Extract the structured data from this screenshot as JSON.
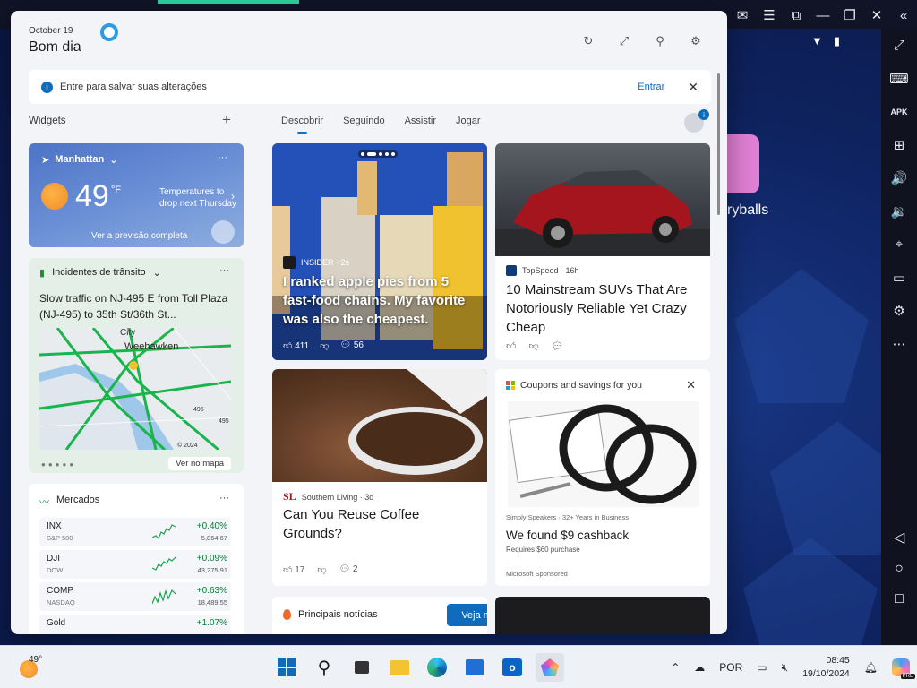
{
  "emulator": {
    "app_label": "ryballs",
    "top_icons": [
      "help-icon",
      "mail-icon",
      "menu-icon",
      "expand-icon",
      "minimize-icon",
      "restore-icon",
      "close-icon",
      "collapse-icon"
    ],
    "side_icons": [
      "fullscreen-icon",
      "keyboard-icon",
      "apk-icon",
      "add-window-icon",
      "volume-up-icon",
      "volume-down-icon",
      "location-icon",
      "folder-icon",
      "settings-icon",
      "more-icon"
    ]
  },
  "header": {
    "date": "October 19",
    "greeting": "Bom dia"
  },
  "banner": {
    "text": "Entre para salvar suas alterações",
    "action": "Entrar"
  },
  "widgets": {
    "label": "Widgets",
    "add": "+"
  },
  "tabs": [
    "Descobrir",
    "Seguindo",
    "Assistir",
    "Jogar"
  ],
  "avatar_badge": "i",
  "weather": {
    "location": "Manhattan",
    "temp": "49",
    "unit": "°F",
    "forecast": "Temperatures to drop next Thursday",
    "link": "Ver a previsão completa",
    "more": "···"
  },
  "traffic": {
    "title": "Incidentes de trânsito",
    "description": "Slow traffic on NJ-495 E from Toll Plaza (NJ-495) to 35th St/36th St...",
    "map_labels": {
      "city": "City",
      "weehawken": "Weehawken",
      "copyright": "© 2024",
      "route": "495",
      "route2": "495"
    },
    "button": "Ver no mapa",
    "more": "···"
  },
  "markets": {
    "title": "Mercados",
    "more": "···",
    "rows": [
      {
        "symbol": "INX",
        "name": "S&P 500",
        "change": "+0.40%",
        "value": "5,864.67"
      },
      {
        "symbol": "DJI",
        "name": "DOW",
        "change": "+0.09%",
        "value": "43,275.91"
      },
      {
        "symbol": "COMP",
        "name": "NASDAQ",
        "change": "+0.63%",
        "value": "18,489.55"
      },
      {
        "symbol": "Gold",
        "name": "",
        "change": "+1.07%",
        "value": ""
      }
    ]
  },
  "cards": {
    "apple": {
      "source": "INSIDER · 2s",
      "title": "I ranked apple pies from 5 fast-food chains. My favorite was also the cheapest.",
      "likes": "411",
      "comments": "56"
    },
    "suv": {
      "source": "TopSpeed · 16h",
      "title": "10 Mainstream SUVs That Are Notoriously Reliable Yet Crazy Cheap"
    },
    "coffee": {
      "source_mark": "SL",
      "source": "Southern Living · 3d",
      "title": "Can You Reuse Coffee Grounds?",
      "likes": "17",
      "comments": "2"
    },
    "coupon": {
      "header": "Coupons and savings for you",
      "seller": "Simply Speakers · 32+ Years in Business",
      "title": "We found $9 cashback",
      "requirement": "Requires $60 purchase",
      "sponsor": "Microsoft Sponsored"
    },
    "top_news": {
      "label": "Principais notícias",
      "button": "Veja mais"
    }
  },
  "taskbar": {
    "temp": "49°",
    "language": "POR",
    "time": "08:45",
    "date": "19/10/2024",
    "pre_badge": "PRE"
  }
}
